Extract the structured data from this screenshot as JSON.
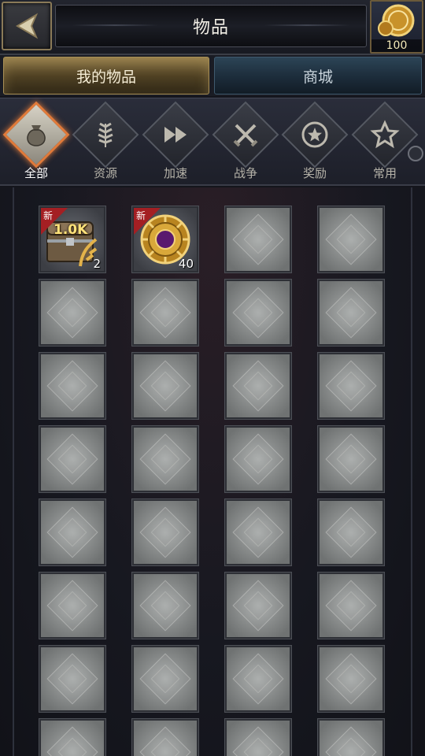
{
  "header": {
    "title": "物品",
    "coins": "100"
  },
  "tabs": [
    {
      "label": "我的物品",
      "active": true
    },
    {
      "label": "商城",
      "active": false
    }
  ],
  "categories": [
    {
      "label": "全部",
      "icon": "bag-icon",
      "active": true
    },
    {
      "label": "资源",
      "icon": "wheat-icon",
      "active": false
    },
    {
      "label": "加速",
      "icon": "fast-forward-icon",
      "active": false
    },
    {
      "label": "战争",
      "icon": "crossed-swords-icon",
      "active": false
    },
    {
      "label": "奖励",
      "icon": "star-badge-icon",
      "active": false
    },
    {
      "label": "常用",
      "icon": "star-icon",
      "active": false
    }
  ],
  "items": [
    {
      "name": "resource-chest",
      "badge": "新",
      "amount": "1.0K",
      "count": "2",
      "icon": "chest-icon"
    },
    {
      "name": "gold-medallion",
      "badge": "新",
      "amount": "",
      "count": "40",
      "icon": "medallion-icon"
    }
  ],
  "colors": {
    "active_border": "#e07a3a",
    "badge_red": "#a41f23",
    "tab_gold": "#7e6a3e",
    "tab_blue": "#2c4456"
  }
}
